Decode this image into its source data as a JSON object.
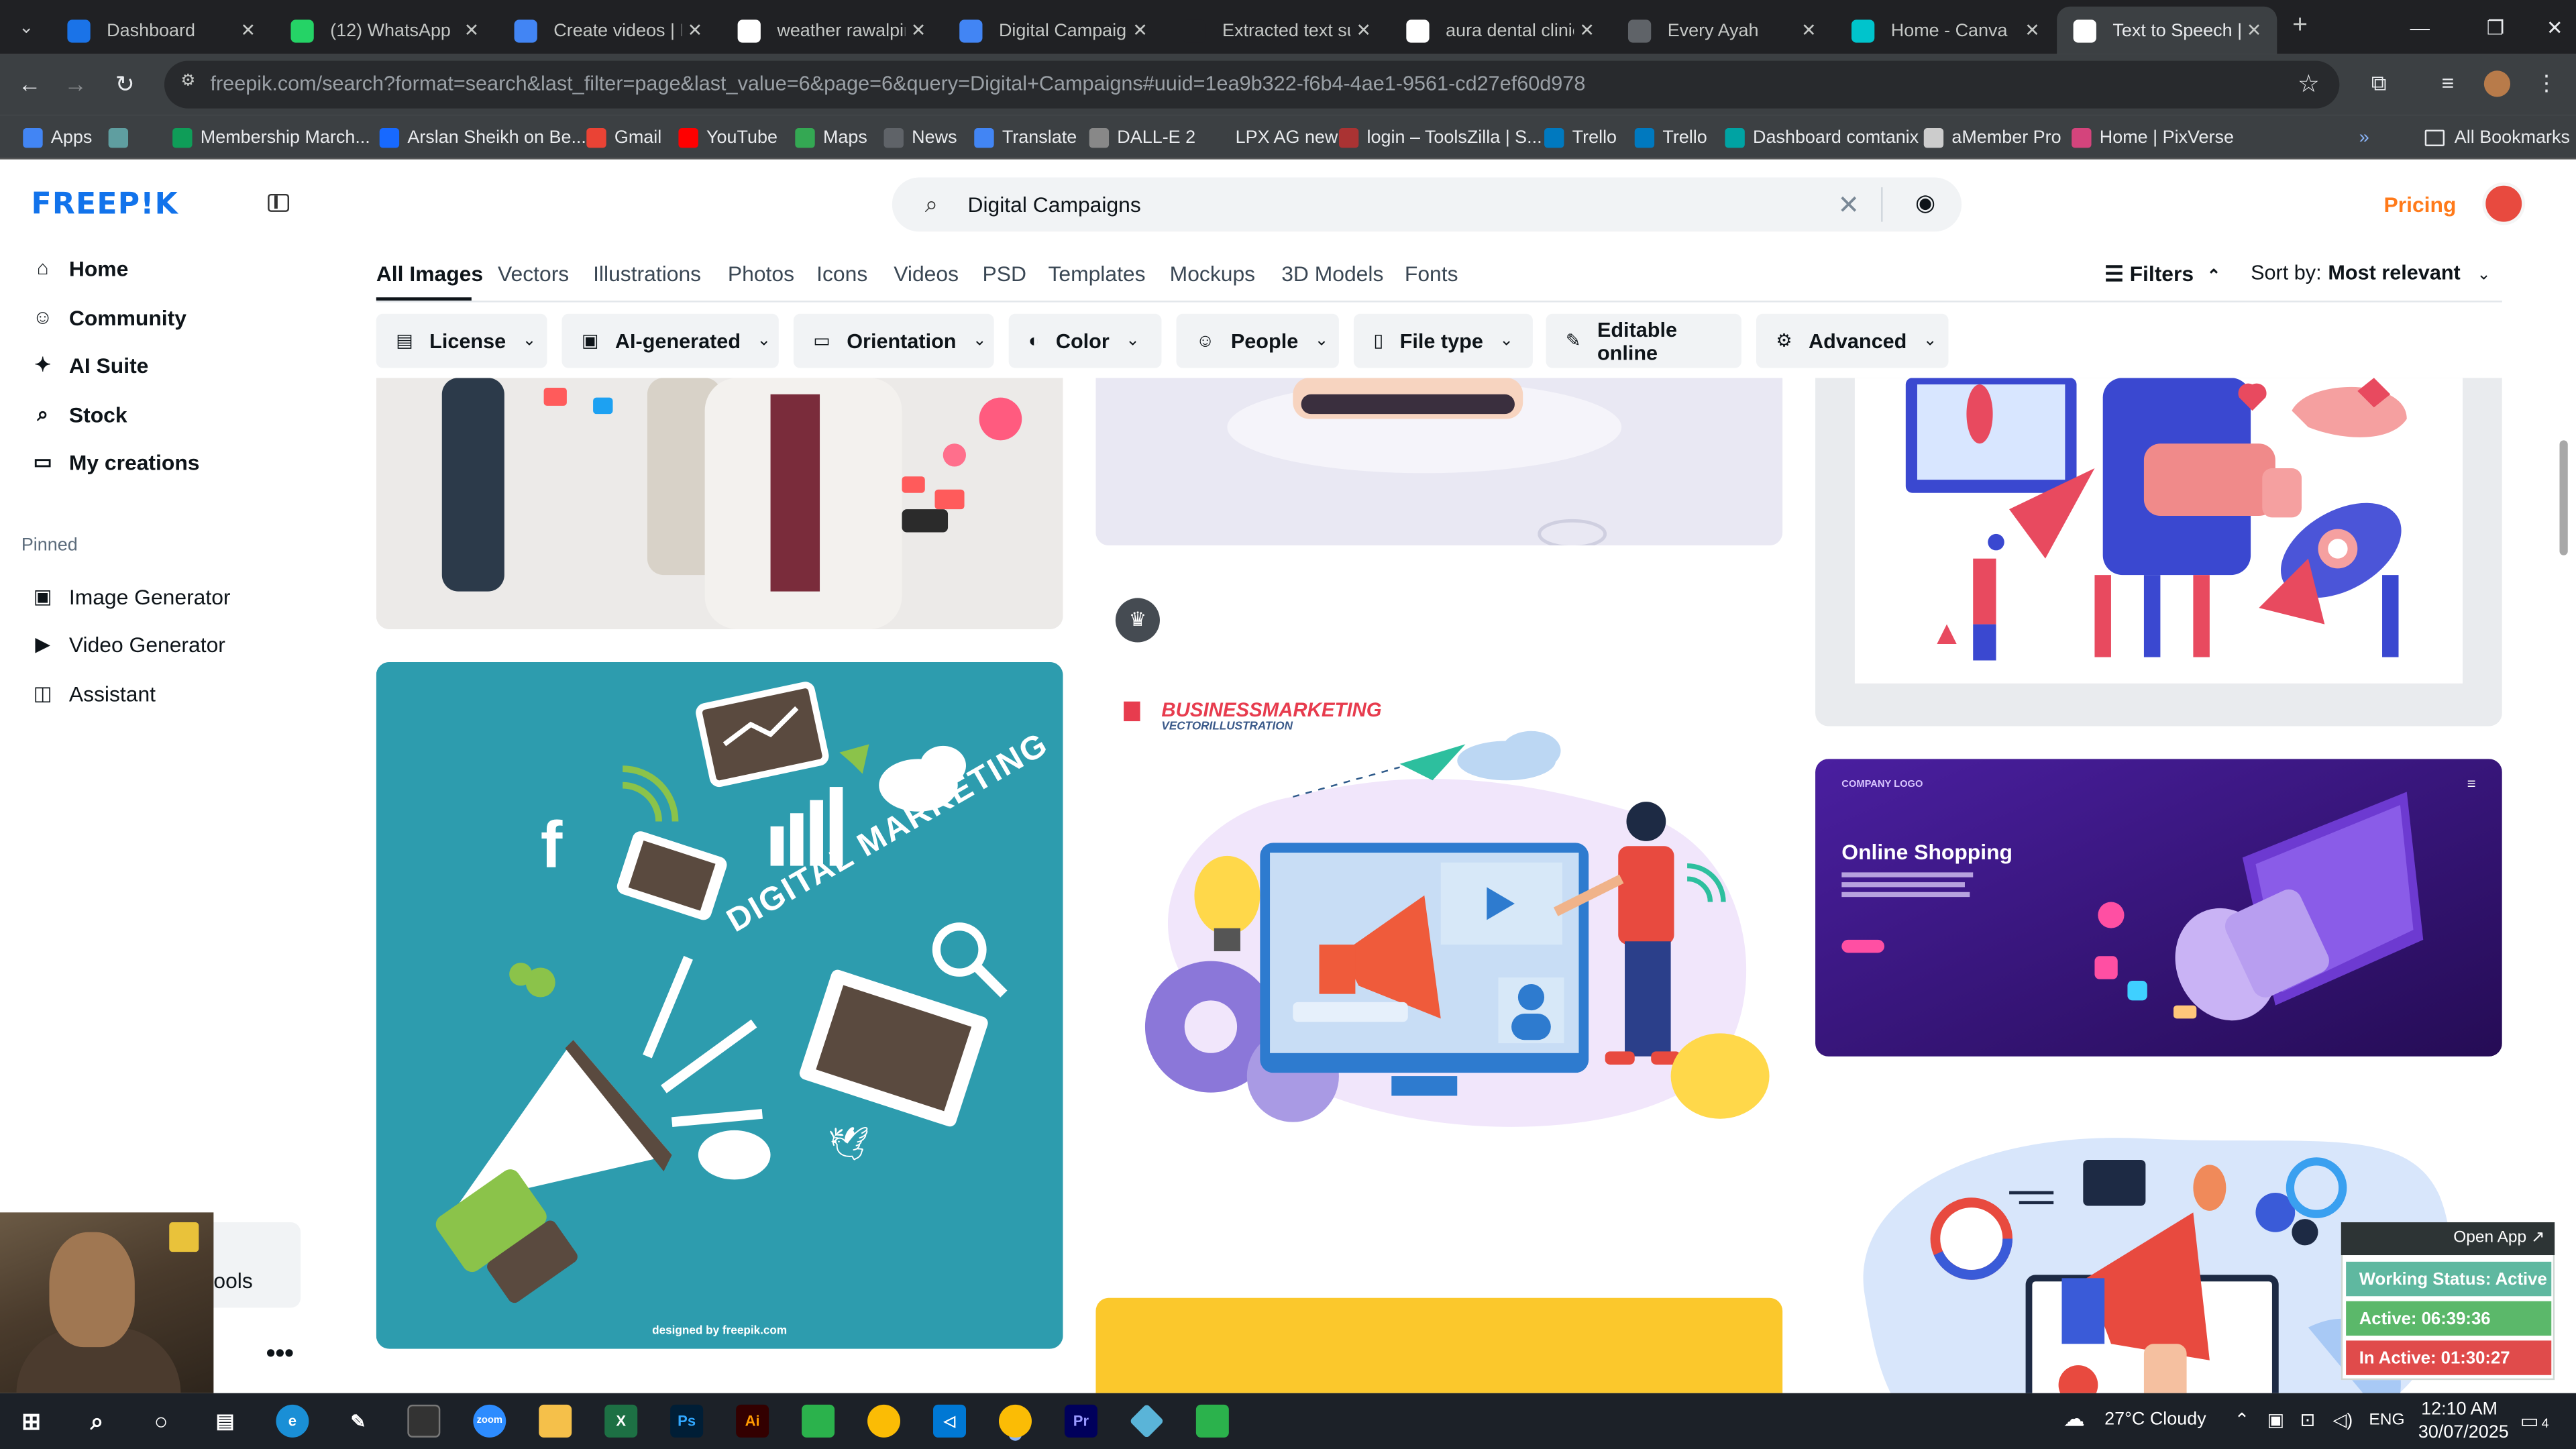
{
  "browser": {
    "tabs": [
      {
        "title": "Dashboard",
        "icon": "dashboard-favicon",
        "color": "#1a73e8"
      },
      {
        "title": "(12) WhatsApp",
        "icon": "whatsapp-favicon",
        "color": "#25d366"
      },
      {
        "title": "Create videos | Fr",
        "icon": "docs-favicon",
        "color": "#4285f4"
      },
      {
        "title": "weather rawalpind",
        "icon": "google-favicon",
        "color": "#ffffff"
      },
      {
        "title": "Digital Campaign",
        "icon": "docs-favicon",
        "color": "#4285f4"
      },
      {
        "title": "Extracted text sur",
        "icon": "openai-favicon",
        "color": "#202124"
      },
      {
        "title": "aura dental clinic",
        "icon": "google-favicon",
        "color": "#ffffff"
      },
      {
        "title": "Every Ayah",
        "icon": "globe-favicon",
        "color": "#5f6368"
      },
      {
        "title": "Home - Canva",
        "icon": "canva-favicon",
        "color": "#00c4cc"
      },
      {
        "title": "Text to Speech | E",
        "icon": "tts-favicon",
        "color": "#ffffff"
      }
    ],
    "active_tab_index": 9,
    "url": "freepik.com/search?format=search&last_filter=page&last_value=6&page=6&query=Digital+Campaigns#uuid=1ea9b322-f6b4-4ae1-9561-cd27ef60d978",
    "bookmarks": [
      {
        "label": "Apps",
        "color": "#4285f4"
      },
      {
        "label": "",
        "color": "#5f9ea0"
      },
      {
        "label": "Membership March...",
        "color": "#0f9d58"
      },
      {
        "label": "Arslan Sheikh on Be...",
        "color": "#1769ff"
      },
      {
        "label": "Gmail",
        "color": "#ea4335"
      },
      {
        "label": "YouTube",
        "color": "#ff0000"
      },
      {
        "label": "Maps",
        "color": "#34a853"
      },
      {
        "label": "News",
        "color": "#5f6368"
      },
      {
        "label": "Translate",
        "color": "#4285f4"
      },
      {
        "label": "DALL-E 2",
        "color": "#888888"
      },
      {
        "label": "LPX AG new",
        "color": "#3c4043"
      },
      {
        "label": "login – ToolsZilla | S...",
        "color": "#a33"
      },
      {
        "label": "Trello",
        "color": "#0079bf"
      },
      {
        "label": "Trello",
        "color": "#0079bf"
      },
      {
        "label": "Dashboard comtanix",
        "color": "#00a3a3"
      },
      {
        "label": "aMember Pro",
        "color": "#cccccc"
      },
      {
        "label": "Home | PixVerse",
        "color": "#d4447c"
      }
    ],
    "all_bookmarks": "All Bookmarks"
  },
  "freepik": {
    "logo": "FREEP!K",
    "search": {
      "query": "Digital Campaigns"
    },
    "pricing": "Pricing",
    "nav": [
      {
        "label": "Home",
        "icon": "home-icon"
      },
      {
        "label": "Community",
        "icon": "community-icon"
      },
      {
        "label": "AI Suite",
        "icon": "sparkle-icon"
      },
      {
        "label": "Stock",
        "icon": "search-icon"
      },
      {
        "label": "My creations",
        "icon": "folder-icon"
      }
    ],
    "pinned_label": "Pinned",
    "pinned": [
      {
        "label": "Image Generator",
        "icon": "image-icon"
      },
      {
        "label": "Video Generator",
        "icon": "video-icon"
      },
      {
        "label": "Assistant",
        "icon": "chat-icon"
      }
    ],
    "type_tabs": [
      "All Images",
      "Vectors",
      "Illustrations",
      "Photos",
      "Icons",
      "Videos",
      "PSD",
      "Templates",
      "Mockups",
      "3D Models",
      "Fonts"
    ],
    "active_type_tab": "All Images",
    "filters_label": "Filters",
    "sort": {
      "label": "Sort by:",
      "value": "Most relevant"
    },
    "chips": [
      {
        "label": "License",
        "icon": "license-icon"
      },
      {
        "label": "AI-generated",
        "icon": "ai-icon"
      },
      {
        "label": "Orientation",
        "icon": "orientation-icon"
      },
      {
        "label": "Color",
        "icon": "palette-icon"
      },
      {
        "label": "People",
        "icon": "people-icon"
      },
      {
        "label": "File type",
        "icon": "file-icon"
      },
      {
        "label": "Editable online",
        "icon": "brush-icon"
      },
      {
        "label": "Advanced",
        "icon": "gear-icon"
      }
    ],
    "results": {
      "digital_marketing": {
        "title": "DIGITAL MARKETING",
        "credit": "designed by freepik.com"
      },
      "business_marketing": {
        "title": "BUSINESSMARKETING",
        "subtitle": "VECTORILLUSTRATION"
      },
      "online_shopping": {
        "title": "Online Shopping",
        "company": "COMPANY LOGO"
      }
    },
    "sidebar_partial_label": "ools"
  },
  "tracker": {
    "open_app": "Open App ↗",
    "working_status": "Working Status: Active",
    "active": "Active: 06:39:36",
    "inactive": "In Active: 01:30:27",
    "colors": {
      "working": "#5fb8a0",
      "active": "#5bb86a",
      "inactive": "#e04b4b"
    }
  },
  "taskbar": {
    "weather": "27°C  Cloudy",
    "language": "ENG",
    "time": "12:10 AM",
    "date": "30/07/2025",
    "notification_count": "4"
  }
}
